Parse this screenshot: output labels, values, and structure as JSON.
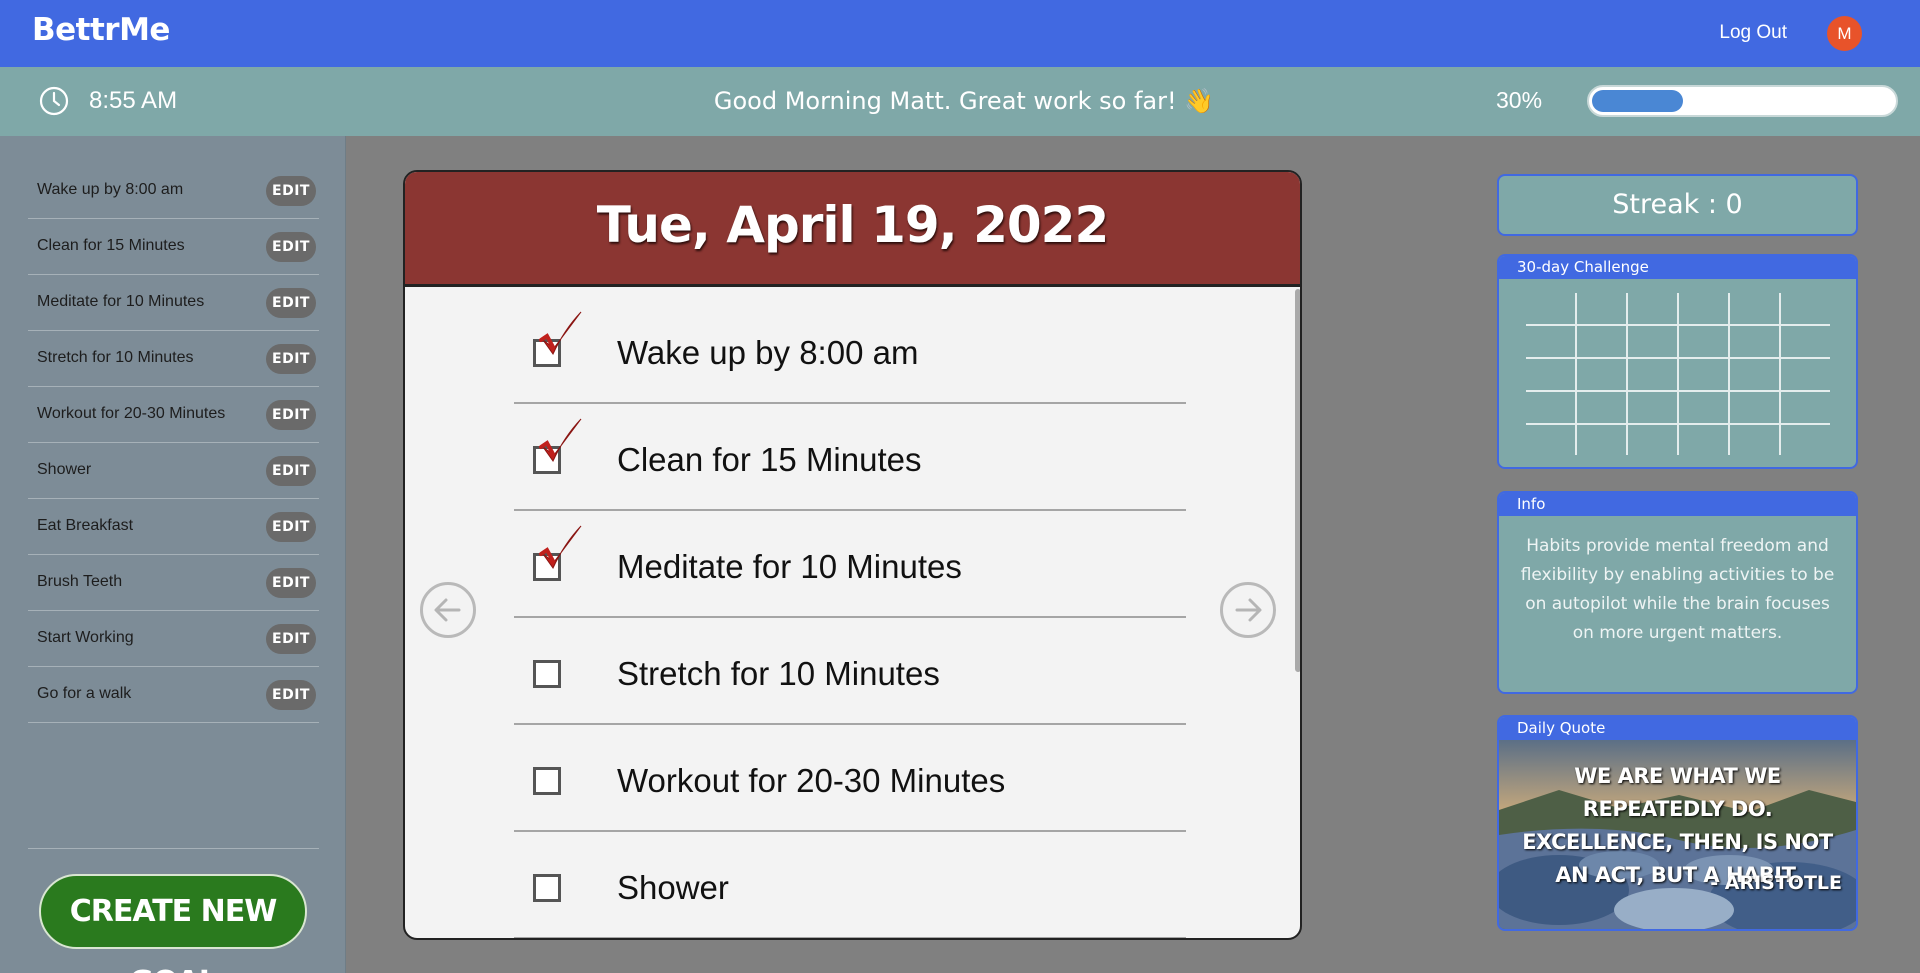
{
  "app": {
    "brand": "BettrMe",
    "logout_label": "Log Out",
    "avatar_initial": "M"
  },
  "status": {
    "time": "8:55 AM",
    "greeting": "Good Morning Matt.  Great work so far! 👋",
    "progress_label": "30%",
    "progress_value": 0.3
  },
  "sidebar": {
    "goals": [
      {
        "label": "Wake up by 8:00 am",
        "edit_label": "EDIT"
      },
      {
        "label": "Clean for 15 Minutes",
        "edit_label": "EDIT"
      },
      {
        "label": "Meditate for 10 Minutes",
        "edit_label": "EDIT"
      },
      {
        "label": "Stretch for 10 Minutes",
        "edit_label": "EDIT"
      },
      {
        "label": "Workout for 20-30 Minutes",
        "edit_label": "EDIT"
      },
      {
        "label": "Shower",
        "edit_label": "EDIT"
      },
      {
        "label": "Eat Breakfast",
        "edit_label": "EDIT"
      },
      {
        "label": "Brush Teeth",
        "edit_label": "EDIT"
      },
      {
        "label": "Start Working",
        "edit_label": "EDIT"
      },
      {
        "label": "Go for a walk",
        "edit_label": "EDIT"
      }
    ],
    "create_label": "CREATE NEW GOAL"
  },
  "tasks_card": {
    "date": "Tue, April 19, 2022",
    "tasks": [
      {
        "label": "Wake up by 8:00 am",
        "checked": true
      },
      {
        "label": "Clean for 15 Minutes",
        "checked": true
      },
      {
        "label": "Meditate for 10 Minutes",
        "checked": true
      },
      {
        "label": "Stretch for 10 Minutes",
        "checked": false
      },
      {
        "label": "Workout for 20-30 Minutes",
        "checked": false
      },
      {
        "label": "Shower",
        "checked": false
      }
    ]
  },
  "right": {
    "streak": "Streak : 0",
    "challenge_title": "30-day Challenge",
    "info_title": "Info",
    "info_text": "Habits provide mental freedom and flexibility by enabling activities to be on autopilot while the brain focuses on more urgent matters.",
    "quote_title": "Daily Quote",
    "quote_text": "WE ARE WHAT WE REPEATEDLY DO. EXCELLENCE, THEN, IS NOT AN ACT, BUT A HABIT.",
    "quote_author": "- ARISTOTLE"
  },
  "colors": {
    "topbar": "#4169e1",
    "subbar": "#7fa8a8",
    "card_header": "#8b3632",
    "create_button": "#2a7a1e",
    "checkmark": "#c0201c",
    "progress_fill": "#4a87d4"
  },
  "icons": {
    "clock": "clock-icon",
    "prev": "arrow-left-circle-icon",
    "next": "arrow-right-circle-icon",
    "check": "checkmark-icon"
  }
}
